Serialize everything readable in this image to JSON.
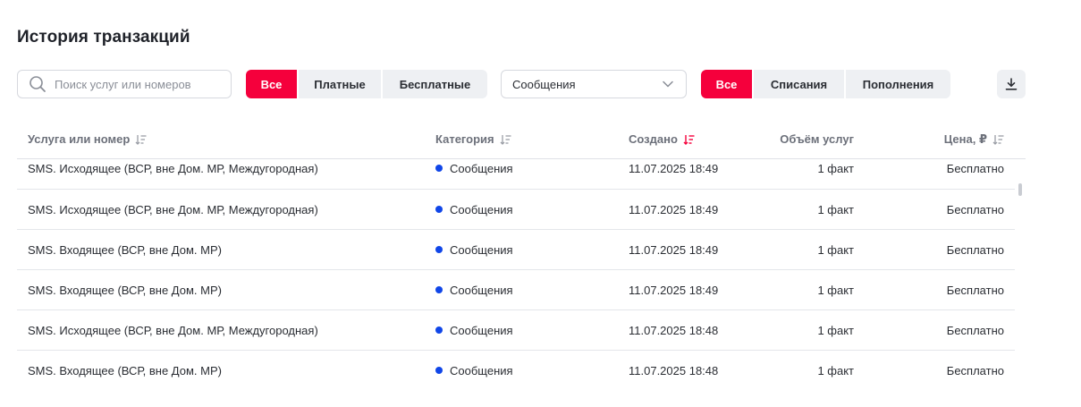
{
  "page": {
    "title": "История транзакций"
  },
  "search": {
    "placeholder": "Поиск услуг или номеров"
  },
  "paid_filter": {
    "items": [
      "Все",
      "Платные",
      "Бесплатные"
    ],
    "active_index": 0
  },
  "category_select": {
    "value": "Сообщения"
  },
  "direction_filter": {
    "items": [
      "Все",
      "Списания",
      "Пополнения"
    ],
    "active_index": 0
  },
  "toolbar": {
    "download_icon": "download-icon"
  },
  "colors": {
    "accent": "#f5003c",
    "category_dot": "#1046e8",
    "segment_bg": "#eef0f3"
  },
  "table": {
    "columns": {
      "service": "Услуга или номер",
      "category": "Категория",
      "created": "Создано",
      "volume": "Объём услуг",
      "price": "Цена, ₽"
    },
    "sort_active_column": "created",
    "rows": [
      {
        "service": "SMS. Исходящее (ВСР, вне Дом. МР, Междугородная)",
        "category": "Сообщения",
        "created": "11.07.2025 18:49",
        "volume": "1 факт",
        "price": "Бесплатно"
      },
      {
        "service": "SMS. Исходящее (ВСР, вне Дом. МР, Междугородная)",
        "category": "Сообщения",
        "created": "11.07.2025 18:49",
        "volume": "1 факт",
        "price": "Бесплатно"
      },
      {
        "service": "SMS. Входящее (ВСР, вне Дом. МР)",
        "category": "Сообщения",
        "created": "11.07.2025 18:49",
        "volume": "1 факт",
        "price": "Бесплатно"
      },
      {
        "service": "SMS. Входящее (ВСР, вне Дом. МР)",
        "category": "Сообщения",
        "created": "11.07.2025 18:49",
        "volume": "1 факт",
        "price": "Бесплатно"
      },
      {
        "service": "SMS. Исходящее (ВСР, вне Дом. МР, Междугородная)",
        "category": "Сообщения",
        "created": "11.07.2025 18:48",
        "volume": "1 факт",
        "price": "Бесплатно"
      },
      {
        "service": "SMS. Входящее (ВСР, вне Дом. МР)",
        "category": "Сообщения",
        "created": "11.07.2025 18:48",
        "volume": "1 факт",
        "price": "Бесплатно"
      }
    ]
  }
}
